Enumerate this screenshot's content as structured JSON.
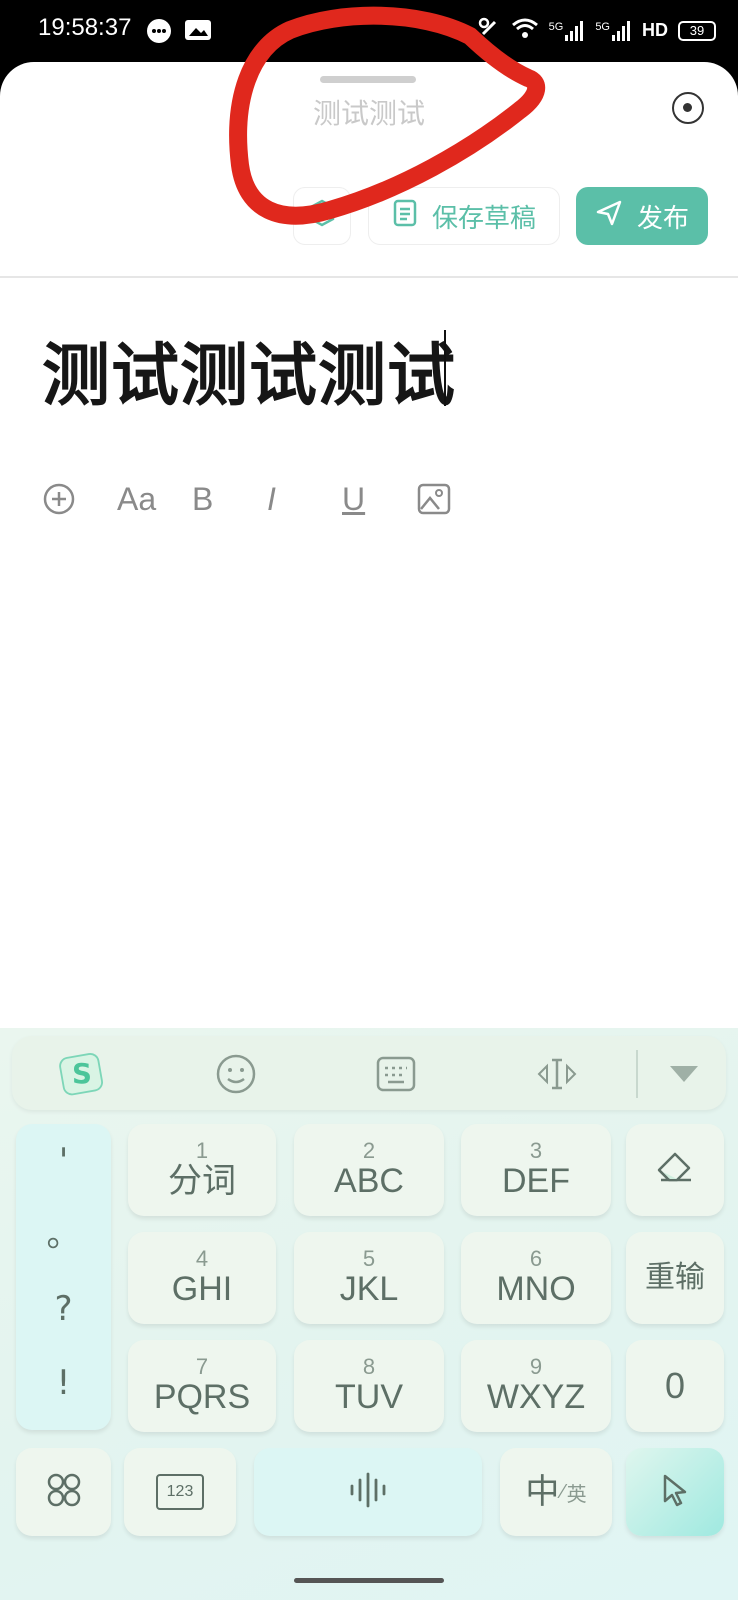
{
  "status_bar": {
    "time": "19:58:37",
    "network": "HD",
    "battery": "39",
    "tech1": "5G",
    "tech2": "5G"
  },
  "sheet": {
    "title": "测试测试"
  },
  "toolbar": {
    "draft_label": "保存草稿",
    "publish_label": "发布"
  },
  "editor": {
    "title_text": "测试测试测试"
  },
  "format_bar": {
    "items": [
      "add-icon",
      "font-size-icon",
      "bold-icon",
      "italic-icon",
      "underline-icon",
      "image-icon"
    ],
    "font_label": "Aa",
    "bold_label": "B",
    "italic_label": "I",
    "underline_label": "U"
  },
  "keyboard": {
    "punct": [
      "'",
      "。",
      "?",
      "!"
    ],
    "keys": [
      {
        "num": "1",
        "label": "分词"
      },
      {
        "num": "2",
        "label": "ABC"
      },
      {
        "num": "3",
        "label": "DEF"
      },
      {
        "num": "4",
        "label": "GHI"
      },
      {
        "num": "5",
        "label": "JKL"
      },
      {
        "num": "6",
        "label": "MNO"
      },
      {
        "num": "7",
        "label": "PQRS"
      },
      {
        "num": "8",
        "label": "TUV"
      },
      {
        "num": "9",
        "label": "WXYZ"
      }
    ],
    "retype_label": "重输",
    "zero_label": "0",
    "lang_main": "中",
    "lang_alt": "英",
    "numpad_label": "123",
    "accent_color": "#5bbfa8"
  }
}
